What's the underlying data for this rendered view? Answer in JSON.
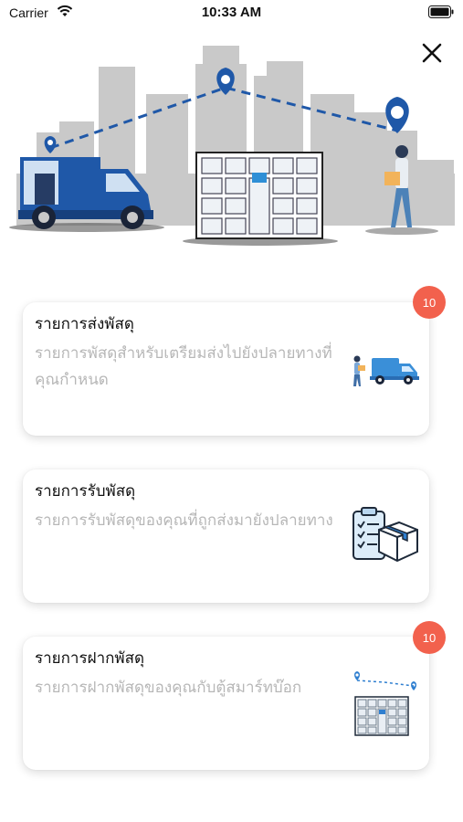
{
  "status_bar": {
    "carrier": "Carrier",
    "time": "10:33 AM"
  },
  "icons": {
    "close": "close-icon",
    "wifi": "wifi-icon",
    "battery": "battery-icon"
  },
  "colors": {
    "badge": "#f2614d",
    "brand_blue": "#1f58a8",
    "card_desc": "#b7b7b7"
  },
  "menu": [
    {
      "title": "รายการส่งพัสดุ",
      "description": "รายการพัสดุสำหรับเตรียมส่งไปยังปลายทางที่คุณกำหนด",
      "badge": "10",
      "icon": "delivery-truck-icon"
    },
    {
      "title": "รายการรับพัสดุ",
      "description": "รายการรับพัสดุของคุณที่ถูกส่งมายังปลายทาง",
      "badge": "",
      "icon": "clipboard-package-icon"
    },
    {
      "title": "รายการฝากพัสดุ",
      "description": "รายการฝากพัสดุของคุณกับตู้สมาร์ทบ๊อก",
      "badge": "10",
      "icon": "smart-locker-icon"
    }
  ]
}
